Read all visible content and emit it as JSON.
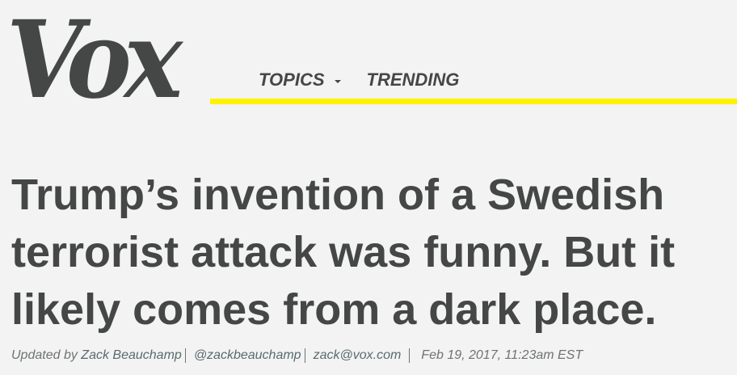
{
  "header": {
    "logo_text": "Vox",
    "nav": {
      "topics_label": "TOPICS",
      "trending_label": "TRENDING"
    },
    "accent_color": "#fff200"
  },
  "article": {
    "headline": "Trump’s invention of a Swedish terrorist attack was funny. But it likely comes from a dark place.",
    "byline": {
      "updated_prefix": "Updated by ",
      "author": "Zack Beauchamp",
      "twitter": "@zackbeauchamp",
      "email": "zack@vox.com",
      "timestamp": "Feb 19, 2017, 11:23am EST"
    }
  }
}
